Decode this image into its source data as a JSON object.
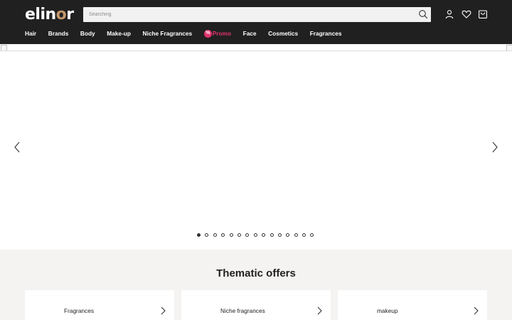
{
  "header": {
    "logo": {
      "prefix": "elin",
      "accent": "o",
      "suffix": "r"
    },
    "search": {
      "placeholder": "Searching"
    },
    "icons": [
      "search-icon",
      "user-icon",
      "heart-icon",
      "cart-icon"
    ]
  },
  "nav": {
    "items": [
      {
        "label": "Hair"
      },
      {
        "label": "Brands"
      },
      {
        "label": "Body"
      },
      {
        "label": "Make-up"
      },
      {
        "label": "Niche Fragrances"
      },
      {
        "label": "Promo",
        "badge": "%"
      },
      {
        "label": "Face"
      },
      {
        "label": "Cosmetics"
      },
      {
        "label": "Fragrances"
      }
    ]
  },
  "hero": {
    "slides": 15,
    "active_slide": 1
  },
  "thematic": {
    "title": "Thematic offers",
    "cards": [
      {
        "label": "Fragrances"
      },
      {
        "label": "Niche fragrances"
      },
      {
        "label": "makeup"
      }
    ]
  },
  "colors": {
    "header_bg": "#202020",
    "logo_accent": "#c4966a",
    "promo": "#e0336c",
    "section_bg": "#f5f3f1"
  }
}
